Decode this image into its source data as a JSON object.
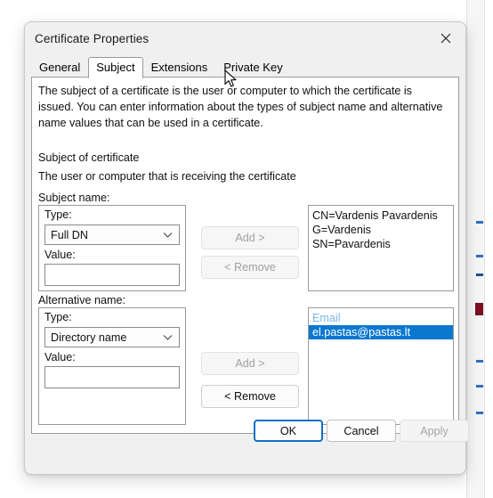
{
  "window": {
    "title": "Certificate Properties",
    "close_icon": "close-icon"
  },
  "tabs": [
    {
      "label": "General",
      "active": false
    },
    {
      "label": "Subject",
      "active": true
    },
    {
      "label": "Extensions",
      "active": false
    },
    {
      "label": "Private Key",
      "active": false
    }
  ],
  "panel": {
    "description": "The subject of a certificate is the user or computer to which the certificate is issued. You can enter information about the types of subject name and alternative name values that can be used in a certificate.",
    "section_title": "Subject of certificate",
    "section_subtitle": "The user or computer that is receiving the certificate"
  },
  "subject_name": {
    "group_label": "Subject name:",
    "type_label": "Type:",
    "type_value": "Full DN",
    "value_label": "Value:",
    "value_text": "",
    "value_placeholder": "",
    "add_label": "Add >",
    "add_enabled": false,
    "remove_label": "< Remove",
    "remove_enabled": false,
    "list": [
      {
        "text": "CN=Vardenis Pavardenis",
        "style": "normal"
      },
      {
        "text": "G=Vardenis",
        "style": "normal"
      },
      {
        "text": "SN=Pavardenis",
        "style": "normal"
      }
    ]
  },
  "alternative_name": {
    "group_label": "Alternative name:",
    "type_label": "Type:",
    "type_value": "Directory name",
    "value_label": "Value:",
    "value_text": "",
    "value_placeholder": "",
    "add_label": "Add >",
    "add_enabled": false,
    "remove_label": "< Remove",
    "remove_enabled": true,
    "list": [
      {
        "text": "Email",
        "style": "header"
      },
      {
        "text": "el.pastas@pastas.lt",
        "style": "selected"
      }
    ]
  },
  "footer": {
    "ok_label": "OK",
    "cancel_label": "Cancel",
    "apply_label": "Apply",
    "apply_enabled": false
  },
  "colors": {
    "selection_blue": "#0b78d0",
    "focus_blue": "#1070c4",
    "list_header_blue": "#77b9e8",
    "dialog_bg": "#f0f0f0",
    "panel_bg": "#ffffff",
    "border_gray": "#9a9a9a",
    "disabled_text": "#a0a0a0"
  }
}
